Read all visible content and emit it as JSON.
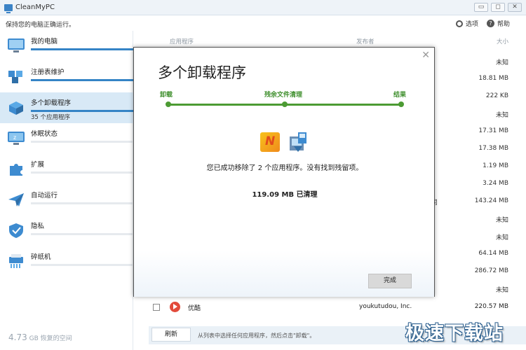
{
  "window": {
    "title": "CleanMyPC",
    "minimize": "▭",
    "maximize": "◻",
    "close": "✕"
  },
  "header": {
    "tagline": "保持您的电脑正确运行。",
    "options": "选项",
    "help": "帮助",
    "help_glyph": "?"
  },
  "sidebar": {
    "items": [
      {
        "label": "我的电脑",
        "progress": 1.0
      },
      {
        "label": "注册表维护",
        "progress": 1.0
      },
      {
        "label": "多个卸载程序",
        "progress": 1.0,
        "sub": "35 个应用程序",
        "active": true
      },
      {
        "label": "休眠状态",
        "progress": 0.0
      },
      {
        "label": "扩展",
        "progress": 0.0
      },
      {
        "label": "自动运行",
        "progress": 0.0
      },
      {
        "label": "隐私",
        "progress": 0.0
      },
      {
        "label": "碎纸机",
        "progress": 0.0
      }
    ],
    "space_amount": "4.73",
    "space_text": "GB 恢复的空间"
  },
  "list": {
    "columns": {
      "app": "应用程序",
      "publisher": "发布者",
      "size": "大小"
    },
    "sizes": [
      "未知",
      "18.81 MB",
      "222 KB",
      "未知",
      "17.31 MB",
      "17.38 MB",
      "1.19 MB",
      "3.24 MB",
      "143.24 MB",
      "未知",
      "未知",
      "64.14 MB",
      "286.72 MB",
      "未知"
    ],
    "partial_text": "司",
    "row": {
      "name": "优酷",
      "publisher": "youkutudou, Inc.",
      "size": "220.57 MB"
    }
  },
  "bottom": {
    "refresh": "刷新",
    "hint": "从列表中选择任何应用程序，然后点击\"卸载\"。"
  },
  "dialog": {
    "close": "✕",
    "title": "多个卸载程序",
    "steps": [
      "卸载",
      "残余文件清理",
      "结果"
    ],
    "message": "您已成功移除了 2 个应用程序。没有找到残留项。",
    "cleaned": "119.09 MB 已清理",
    "done": "完成"
  },
  "watermark": "极速下载站",
  "colors": {
    "accent": "#3584c6",
    "progress_green": "#4c9b33",
    "sidebar_active": "#d8e9f6"
  }
}
